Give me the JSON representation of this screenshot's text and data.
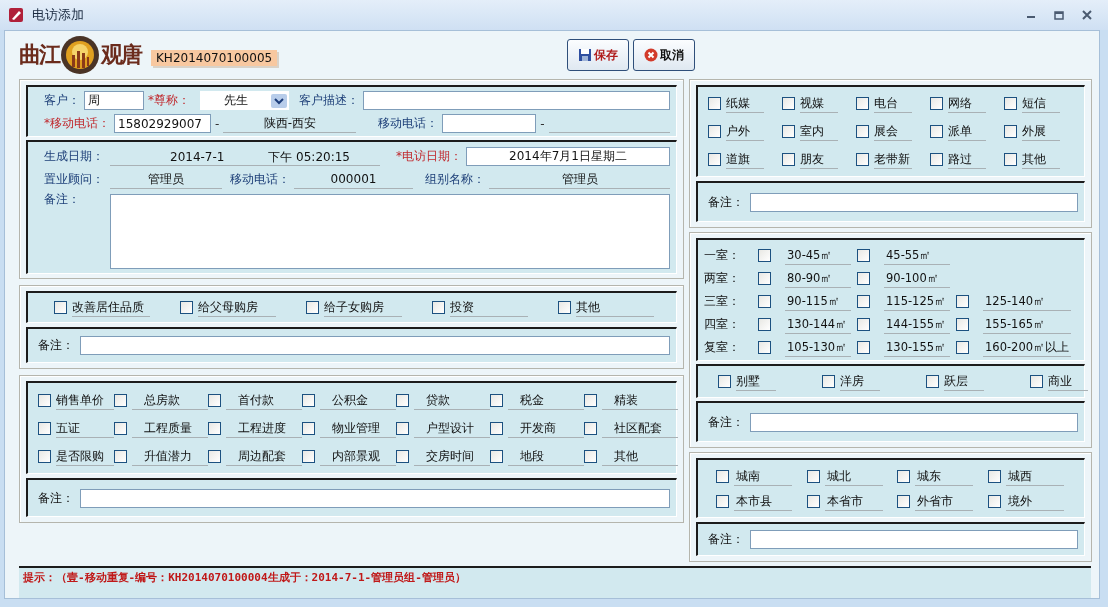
{
  "window": {
    "title": "电访添加"
  },
  "logo": {
    "left": "曲江",
    "right": "观唐"
  },
  "record_code": "KH2014070100005",
  "buttons": [
    {
      "kind": "save",
      "label": "保存"
    },
    {
      "kind": "cancel",
      "label": "取消"
    }
  ],
  "customer": {
    "name_label": {
      "text": "客户：",
      "required": false
    },
    "name": "周",
    "title_label": {
      "text": "*尊称：",
      "required": true
    },
    "title_value": "先生",
    "desc_label": {
      "text": "客户描述：",
      "required": false
    },
    "mobile_label": {
      "text": "*移动电话：",
      "required": true
    },
    "mobile": "15802929007",
    "dash": "-",
    "region": "陕西-西安",
    "mobile2_label": {
      "text": "移动电话：",
      "required": false
    },
    "dash2": "-"
  },
  "info": {
    "created_label": {
      "text": "生成日期：",
      "required": false
    },
    "created_date": "2014-7-1",
    "created_time": "下午 05:20:15",
    "visit_label": {
      "text": "*电访日期：",
      "required": true
    },
    "visit_date": "2014年7月1日星期二",
    "consultant_label": {
      "text": "置业顾问：",
      "required": false
    },
    "consultant": "管理员",
    "phone_label": {
      "text": "移动电话：",
      "required": false
    },
    "phone": "000001",
    "group_label": {
      "text": "组别名称：",
      "required": false
    },
    "group": "管理员",
    "note_label": "备注："
  },
  "purpose": {
    "options": [
      {
        "label": "改善居住品质",
        "checked": false
      },
      {
        "label": "给父母购房",
        "checked": false
      },
      {
        "label": "给子女购房",
        "checked": false
      },
      {
        "label": "投资",
        "checked": false
      },
      {
        "label": "其他",
        "checked": false
      }
    ],
    "note_label": "备注："
  },
  "concerns": {
    "rows": [
      [
        {
          "label": "销售单价",
          "checked": false
        },
        {
          "label": "总房款",
          "checked": false
        },
        {
          "label": "首付款",
          "checked": false
        },
        {
          "label": "公积金",
          "checked": false
        },
        {
          "label": "贷款",
          "checked": false
        },
        {
          "label": "税金",
          "checked": false
        },
        {
          "label": "精装",
          "checked": false
        }
      ],
      [
        {
          "label": "五证",
          "checked": false
        },
        {
          "label": "工程质量",
          "checked": false
        },
        {
          "label": "工程进度",
          "checked": false
        },
        {
          "label": "物业管理",
          "checked": false
        },
        {
          "label": "户型设计",
          "checked": false
        },
        {
          "label": "开发商",
          "checked": false
        },
        {
          "label": "社区配套",
          "checked": false
        }
      ],
      [
        {
          "label": "是否限购",
          "checked": false
        },
        {
          "label": "升值潜力",
          "checked": false
        },
        {
          "label": "周边配套",
          "checked": false
        },
        {
          "label": "内部景观",
          "checked": false
        },
        {
          "label": "交房时间",
          "checked": false
        },
        {
          "label": "地段",
          "checked": false
        },
        {
          "label": "其他",
          "checked": false
        }
      ]
    ],
    "note_label": "备注："
  },
  "channels": {
    "rows": [
      [
        {
          "label": "纸媒",
          "checked": false
        },
        {
          "label": "视媒",
          "checked": false
        },
        {
          "label": "电台",
          "checked": false
        },
        {
          "label": "网络",
          "checked": false
        },
        {
          "label": "短信",
          "checked": false
        }
      ],
      [
        {
          "label": "户外",
          "checked": false
        },
        {
          "label": "室内",
          "checked": false
        },
        {
          "label": "展会",
          "checked": false
        },
        {
          "label": "派单",
          "checked": false
        },
        {
          "label": "外展",
          "checked": false
        }
      ],
      [
        {
          "label": "道旗",
          "checked": false
        },
        {
          "label": "朋友",
          "checked": false
        },
        {
          "label": "老带新",
          "checked": false
        },
        {
          "label": "路过",
          "checked": false
        },
        {
          "label": "其他",
          "checked": false
        }
      ]
    ],
    "note_label": "备注："
  },
  "layouts": {
    "rows": [
      {
        "label": "一室：",
        "options": [
          {
            "label": "30-45㎡",
            "checked": false
          },
          {
            "label": "45-55㎡",
            "checked": false
          }
        ]
      },
      {
        "label": "两室：",
        "options": [
          {
            "label": "80-90㎡",
            "checked": false
          },
          {
            "label": "90-100㎡",
            "checked": false
          }
        ]
      },
      {
        "label": "三室：",
        "options": [
          {
            "label": "90-115㎡",
            "checked": false
          },
          {
            "label": "115-125㎡",
            "checked": false
          },
          {
            "label": "125-140㎡",
            "checked": false
          }
        ]
      },
      {
        "label": "四室：",
        "options": [
          {
            "label": "130-144㎡",
            "checked": false
          },
          {
            "label": "144-155㎡",
            "checked": false
          },
          {
            "label": "155-165㎡",
            "checked": false
          }
        ]
      },
      {
        "label": "复室：",
        "options": [
          {
            "label": "105-130㎡",
            "checked": false
          },
          {
            "label": "130-155㎡",
            "checked": false
          },
          {
            "label": "160-200㎡以上",
            "checked": false
          }
        ]
      }
    ],
    "types": [
      {
        "label": "别墅",
        "checked": false
      },
      {
        "label": "洋房",
        "checked": false
      },
      {
        "label": "跃层",
        "checked": false
      },
      {
        "label": "商业",
        "checked": false
      }
    ],
    "note_label": "备注："
  },
  "areas": {
    "rows": [
      [
        {
          "label": "城南",
          "checked": false
        },
        {
          "label": "城北",
          "checked": false
        },
        {
          "label": "城东",
          "checked": false
        },
        {
          "label": "城西",
          "checked": false
        }
      ],
      [
        {
          "label": "本市县",
          "checked": false
        },
        {
          "label": "本省市",
          "checked": false
        },
        {
          "label": "外省市",
          "checked": false
        },
        {
          "label": "境外",
          "checked": false
        }
      ]
    ],
    "note_label": "备注："
  },
  "hint": "提示：（壹-移动重复-编号：KH2014070100004生成于：2014-7-1-管理员组-管理员）"
}
